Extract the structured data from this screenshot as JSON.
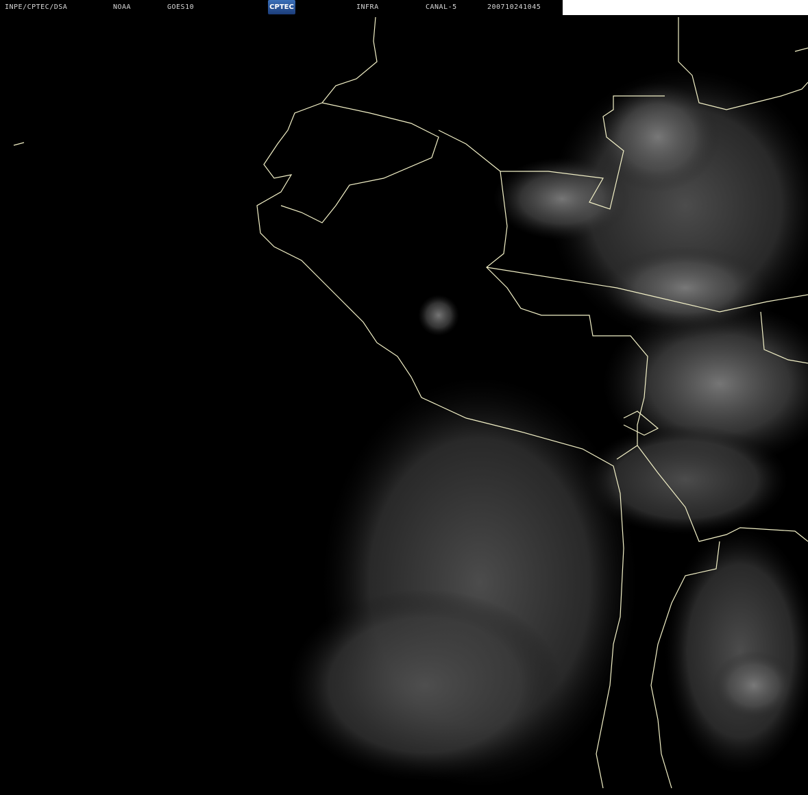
{
  "header": {
    "source": "INPE/CPTEC/DSA",
    "agency": "NOAA",
    "satellite": "GOES10",
    "logo_text": "CPTEC",
    "band": "INFRA",
    "channel": "CANAL-5",
    "timestamp": "200710241045"
  },
  "colors": {
    "background": "#000000",
    "borders": "#f4f2c8",
    "clouds": "#8a8a8a"
  }
}
